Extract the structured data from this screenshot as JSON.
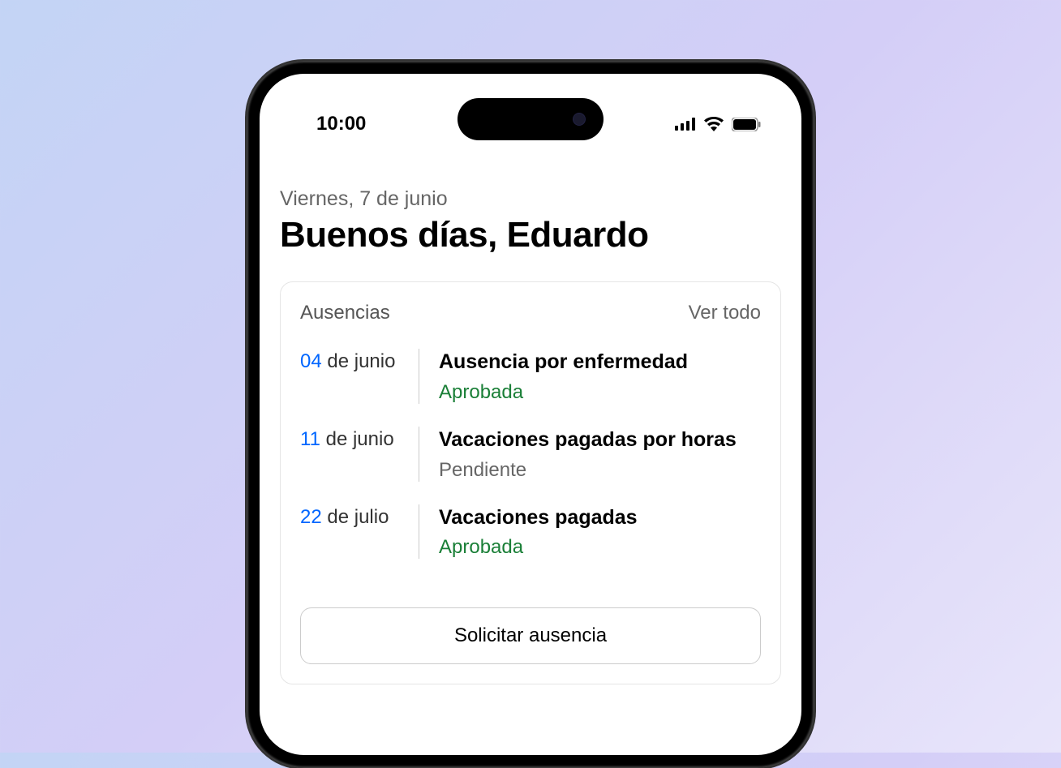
{
  "status_bar": {
    "time": "10:00"
  },
  "header": {
    "date": "Viernes, 7 de junio",
    "greeting": "Buenos días, Eduardo"
  },
  "absences_card": {
    "title": "Ausencias",
    "see_all": "Ver todo",
    "request_button": "Solicitar ausencia",
    "items": [
      {
        "day": "04",
        "month": " de junio",
        "type": "Ausencia por enfermedad",
        "status": "Aprobada",
        "status_class": "status-approved"
      },
      {
        "day": "11",
        "month": " de junio",
        "type": "Vacaciones pagadas por horas",
        "status": "Pendiente",
        "status_class": "status-pending"
      },
      {
        "day": "22",
        "month": " de julio",
        "type": "Vacaciones pagadas",
        "status": "Aprobada",
        "status_class": "status-approved"
      }
    ]
  }
}
